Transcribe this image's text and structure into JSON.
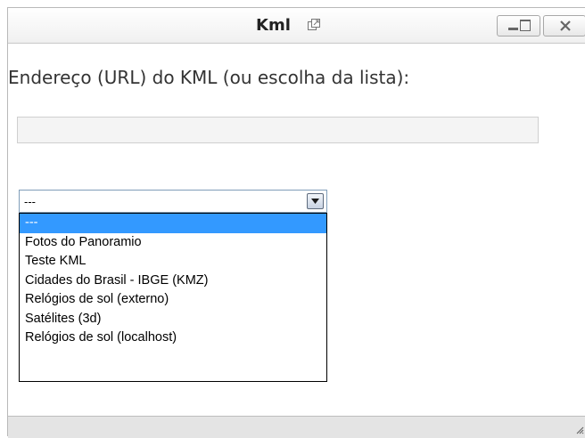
{
  "window": {
    "title": "Kml",
    "icons": {
      "popout": "popout-icon",
      "minmax": "minimize-maximize-icon",
      "close": "close-icon",
      "grip": "resize-grip-icon"
    }
  },
  "form": {
    "label": "Endereço (URL) do KML (ou escolha da lista):",
    "url_value": "",
    "select": {
      "selected": "---",
      "options": [
        "---",
        "Fotos do Panoramio",
        "Teste KML",
        "Cidades do Brasil - IBGE (KMZ)",
        "Relógios de sol (externo)",
        "Satélites (3d)",
        "Relógios de sol (localhost)"
      ],
      "highlighted_index": 0
    }
  },
  "colors": {
    "highlight": "#3399ff",
    "border": "#7f9db9"
  }
}
